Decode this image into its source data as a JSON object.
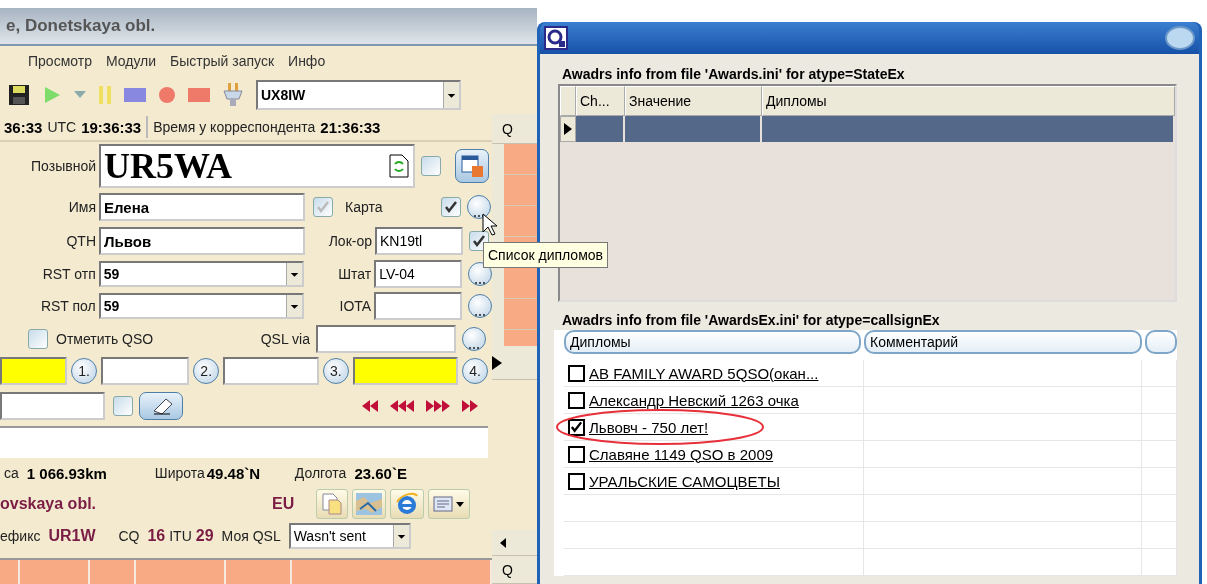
{
  "main_window": {
    "title": "e, Donetskaya obl."
  },
  "menu": [
    {
      "label": "Просмотр"
    },
    {
      "label": "Модули"
    },
    {
      "label": "Быстрый запуск"
    },
    {
      "label": "Инфо"
    }
  ],
  "toolbar": {
    "operator": "UX8IW"
  },
  "time_bar": {
    "local_time": "36:33",
    "utc_label": "UTC",
    "utc_time": "19:36:33",
    "remote_label": "Время у корреспондента",
    "remote_time": "21:36:33"
  },
  "qso_form": {
    "callsign": {
      "label": "Позывной",
      "value": "UR5WA",
      "checked": false
    },
    "clear_checked": false,
    "name": {
      "label": "Имя",
      "value": "Елена"
    },
    "qth": {
      "label": "QTH",
      "value": "Львов"
    },
    "rst_sent": {
      "label": "RST отп",
      "value": "59"
    },
    "rst_rcvd": {
      "label": "RST пол",
      "value": "59"
    },
    "map": {
      "label": "Карта",
      "auto_checked": true,
      "checked": true
    },
    "locator": {
      "label": "Лок-ор",
      "value": "KN19tl",
      "checked": true
    },
    "state": {
      "label": "Штат",
      "value": "LV-04"
    },
    "iota": {
      "label": "IOTA"
    },
    "mark_qso": {
      "label": "Отметить QSO",
      "checked": false
    },
    "qsl_via": {
      "label": "QSL via"
    },
    "memo_slots": [
      {
        "label": "1.",
        "highlighted": true
      },
      {
        "label": "2.",
        "highlighted": false
      },
      {
        "label": "3.",
        "highlighted": false
      },
      {
        "label": "4.",
        "highlighted": true
      }
    ]
  },
  "info": {
    "distance_label": "са",
    "distance": "1 066.93km",
    "lat_label": "Широта",
    "lat": "49.48`N",
    "lon_label": "Долгота",
    "lon": "23.60`E",
    "region": "ovskaya obl.",
    "continent": "EU",
    "prefix_label": "ефикс",
    "prefix": "UR1W",
    "cq_label": "CQ",
    "cq": "16",
    "itu_label": "ITU",
    "itu": "29",
    "my_qsl_label": "Моя QSL",
    "my_qsl": "Wasn't sent"
  },
  "log_strip": {
    "header_top": "Q",
    "header_bottom": "Q"
  },
  "tooltip": "Список дипломов",
  "awards_dialog": {
    "section1_title": "Awadrs info from file 'Awards.ini' for atype=StateEx",
    "grid1": {
      "columns": [
        "Ch...",
        "Значение",
        "Дипломы"
      ],
      "rows": [
        {
          "selected": true
        }
      ]
    },
    "section2_title": "Awadrs info from file 'AwardsEx.ini' for atype=callsignEx",
    "grid2": {
      "columns": [
        "Дипломы",
        "Комментарий"
      ],
      "rows": [
        {
          "award": "AB FAMILY AWARD 5QSO(окан...",
          "checked": false,
          "circled": false
        },
        {
          "award": "Александр Невский 1263 очка",
          "checked": false,
          "circled": false
        },
        {
          "award": "Львовч - 750 лет!",
          "checked": true,
          "circled": true
        },
        {
          "award": "Славяне 1149 QSO в 2009",
          "checked": false,
          "circled": false
        },
        {
          "award": "УРАЛЬСКИЕ САМОЦВЕТЫ",
          "checked": false,
          "circled": false
        }
      ]
    }
  }
}
